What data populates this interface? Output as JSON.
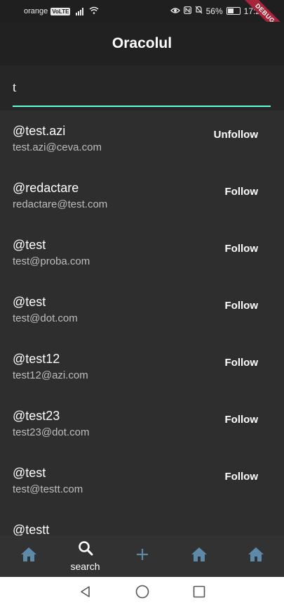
{
  "status_bar": {
    "carrier": "orange",
    "volte": "VoLTE",
    "battery": "56%",
    "battery_level": 0.56,
    "time": "17:2",
    "debug_label": "DEBUG"
  },
  "app_bar": {
    "title": "Oracolul"
  },
  "search": {
    "value": "t",
    "placeholder": ""
  },
  "users": [
    {
      "username": "@test.azi",
      "email": "test.azi@ceva.com",
      "action": "Unfollow"
    },
    {
      "username": "@redactare",
      "email": "redactare@test.com",
      "action": "Follow"
    },
    {
      "username": "@test",
      "email": "test@proba.com",
      "action": "Follow"
    },
    {
      "username": "@test",
      "email": "test@dot.com",
      "action": "Follow"
    },
    {
      "username": "@test12",
      "email": "test12@azi.com",
      "action": "Follow"
    },
    {
      "username": "@test23",
      "email": "test23@dot.com",
      "action": "Follow"
    },
    {
      "username": "@test",
      "email": "test@testt.com",
      "action": "Follow"
    },
    {
      "username": "@testt",
      "email": "",
      "action": ""
    }
  ],
  "bottom_nav": [
    {
      "icon": "home-icon",
      "label": "",
      "active": false
    },
    {
      "icon": "search-icon",
      "label": "search",
      "active": true
    },
    {
      "icon": "add-icon",
      "label": "",
      "active": false
    },
    {
      "icon": "home-icon",
      "label": "",
      "active": false
    },
    {
      "icon": "home-icon",
      "label": "",
      "active": false
    }
  ],
  "colors": {
    "accent": "#64ffda",
    "inactive_icon": "#5d8aa8",
    "background": "#2e2e2e",
    "app_bar": "#212121",
    "debug_ribbon": "#a8243a"
  }
}
